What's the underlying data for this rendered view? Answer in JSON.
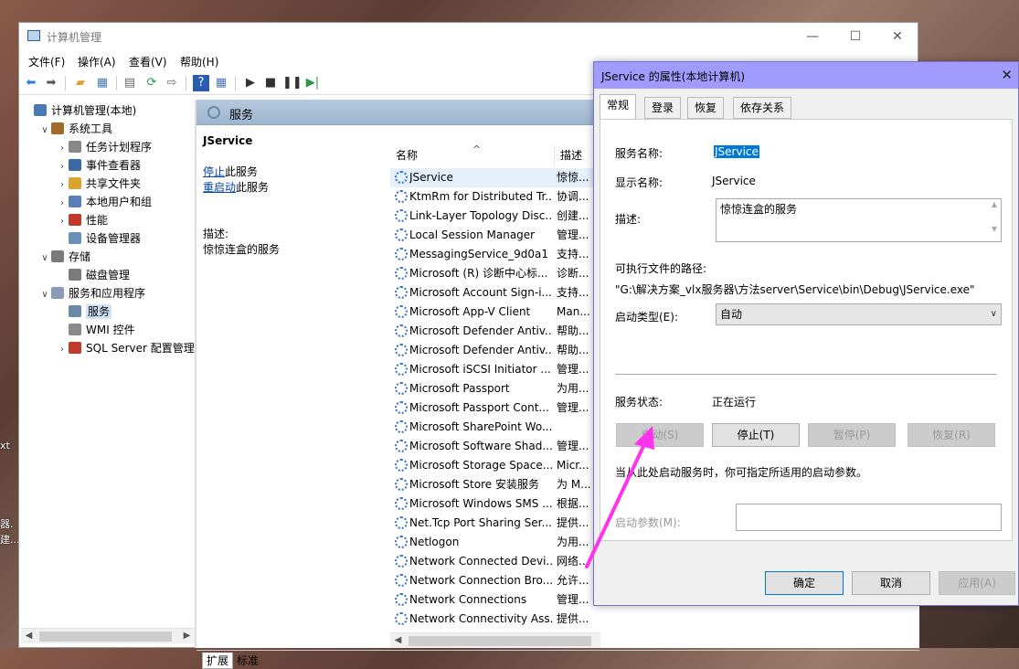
{
  "desktop": {
    "notes": [
      "xt",
      "器.",
      "建..."
    ]
  },
  "main": {
    "title": "计算机管理",
    "window_controls": [
      "—",
      "☐",
      "✕"
    ],
    "menus": [
      "文件(F)",
      "操作(A)",
      "查看(V)",
      "帮助(H)"
    ],
    "tree": [
      {
        "label": "计算机管理(本地)",
        "level": 0,
        "expander": "",
        "icon": "computer-management-icon",
        "color": "#4a7ab5"
      },
      {
        "label": "系统工具",
        "level": 1,
        "expander": "∨",
        "icon": "system-tools-icon",
        "color": "#a06a2a"
      },
      {
        "label": "任务计划程序",
        "level": 2,
        "expander": "›",
        "icon": "task-scheduler-icon",
        "color": "#888888"
      },
      {
        "label": "事件查看器",
        "level": 2,
        "expander": "›",
        "icon": "event-viewer-icon",
        "color": "#3c6aa5"
      },
      {
        "label": "共享文件夹",
        "level": 2,
        "expander": "›",
        "icon": "shared-folder-icon",
        "color": "#d9a52e"
      },
      {
        "label": "本地用户和组",
        "level": 2,
        "expander": "›",
        "icon": "users-groups-icon",
        "color": "#5a7fb8"
      },
      {
        "label": "性能",
        "level": 2,
        "expander": "›",
        "icon": "performance-icon",
        "color": "#c0392b"
      },
      {
        "label": "设备管理器",
        "level": 2,
        "expander": "",
        "icon": "device-manager-icon",
        "color": "#6a8fb8"
      },
      {
        "label": "存储",
        "level": 1,
        "expander": "∨",
        "icon": "storage-icon",
        "color": "#7a7a7a"
      },
      {
        "label": "磁盘管理",
        "level": 2,
        "expander": "",
        "icon": "disk-management-icon",
        "color": "#7a7a7a"
      },
      {
        "label": "服务和应用程序",
        "level": 1,
        "expander": "∨",
        "icon": "services-apps-icon",
        "color": "#8a9ab8"
      },
      {
        "label": "服务",
        "level": 2,
        "expander": "",
        "icon": "services-icon",
        "color": "#6a89a8",
        "selected": true
      },
      {
        "label": "WMI 控件",
        "level": 2,
        "expander": "",
        "icon": "wmi-icon",
        "color": "#8a8a8a"
      },
      {
        "label": "SQL Server 配置管理器",
        "level": 2,
        "expander": "›",
        "icon": "sql-server-icon",
        "color": "#c0392b"
      }
    ],
    "services_header": "服务",
    "selected_service": "JService",
    "links": {
      "stop": "停止",
      "stop_suffix": "此服务",
      "restart": "重启动",
      "restart_suffix": "此服务"
    },
    "description_label": "描述:",
    "description_text": "惊惊连盒的服务",
    "columns": {
      "name": "名称",
      "desc": "描述",
      "sort_arrow": "^"
    },
    "services": [
      {
        "name": "JService",
        "desc": "惊惊...",
        "selected": true
      },
      {
        "name": "KtmRm for Distributed Tr...",
        "desc": "协调..."
      },
      {
        "name": "Link-Layer Topology Disc...",
        "desc": "创建..."
      },
      {
        "name": "Local Session Manager",
        "desc": "管理..."
      },
      {
        "name": "MessagingService_9d0a1",
        "desc": "支持..."
      },
      {
        "name": "Microsoft (R) 诊断中心标...",
        "desc": "诊断..."
      },
      {
        "name": "Microsoft Account Sign-i...",
        "desc": "支持..."
      },
      {
        "name": "Microsoft App-V Client",
        "desc": "Man..."
      },
      {
        "name": "Microsoft Defender Antiv...",
        "desc": "帮助..."
      },
      {
        "name": "Microsoft Defender Antiv...",
        "desc": "帮助..."
      },
      {
        "name": "Microsoft iSCSI Initiator ...",
        "desc": "管理..."
      },
      {
        "name": "Microsoft Passport",
        "desc": "为用..."
      },
      {
        "name": "Microsoft Passport Cont...",
        "desc": "管理..."
      },
      {
        "name": "Microsoft SharePoint Wo...",
        "desc": ""
      },
      {
        "name": "Microsoft Software Shad...",
        "desc": "管理..."
      },
      {
        "name": "Microsoft Storage Space...",
        "desc": "Micr..."
      },
      {
        "name": "Microsoft Store 安装服务",
        "desc": "为 M..."
      },
      {
        "name": "Microsoft Windows SMS ...",
        "desc": "根据..."
      },
      {
        "name": "Net.Tcp Port Sharing Ser...",
        "desc": "提供..."
      },
      {
        "name": "Netlogon",
        "desc": "为用..."
      },
      {
        "name": "Network Connected Devi...",
        "desc": "网络..."
      },
      {
        "name": "Network Connection Bro...",
        "desc": "允许..."
      },
      {
        "name": "Network Connections",
        "desc": "管理..."
      },
      {
        "name": "Network Connectivity Ass...",
        "desc": "提供..."
      }
    ],
    "bottom_tabs": [
      "扩展",
      "标准"
    ]
  },
  "dialog": {
    "title": "JService 的属性(本地计算机)",
    "close": "✕",
    "tabs": [
      "常规",
      "登录",
      "恢复",
      "依存关系"
    ],
    "service_name_label": "服务名称:",
    "service_name": "JService",
    "display_name_label": "显示名称:",
    "display_name": "JService",
    "description_label": "描述:",
    "description": "惊惊连盒的服务",
    "path_label": "可执行文件的路径:",
    "path": "\"G:\\解决方案_vlx服务器\\方法server\\Service\\bin\\Debug\\JService.exe\"",
    "startup_type_label": "启动类型(E):",
    "startup_type": "自动",
    "status_label": "服务状态:",
    "status": "正在运行",
    "buttons": {
      "start": "启动(S)",
      "stop": "停止(T)",
      "pause": "暂停(P)",
      "resume": "恢复(R)"
    },
    "hint": "当从此处启动服务时，你可指定所适用的启动参数。",
    "params_label": "启动参数(M):",
    "ok": "确定",
    "cancel": "取消",
    "apply": "应用(A)",
    "annotation_color": "#ff33ee"
  }
}
